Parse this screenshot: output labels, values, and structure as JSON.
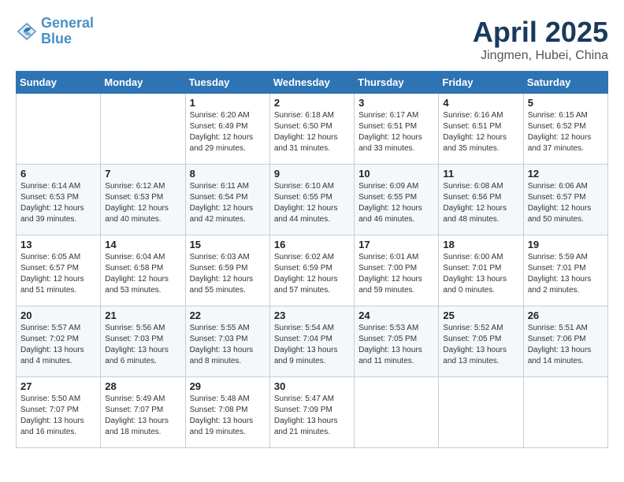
{
  "header": {
    "logo_line1": "General",
    "logo_line2": "Blue",
    "month_title": "April 2025",
    "location": "Jingmen, Hubei, China"
  },
  "days_of_week": [
    "Sunday",
    "Monday",
    "Tuesday",
    "Wednesday",
    "Thursday",
    "Friday",
    "Saturday"
  ],
  "weeks": [
    [
      {
        "day": "",
        "info": ""
      },
      {
        "day": "",
        "info": ""
      },
      {
        "day": "1",
        "info": "Sunrise: 6:20 AM\nSunset: 6:49 PM\nDaylight: 12 hours\nand 29 minutes."
      },
      {
        "day": "2",
        "info": "Sunrise: 6:18 AM\nSunset: 6:50 PM\nDaylight: 12 hours\nand 31 minutes."
      },
      {
        "day": "3",
        "info": "Sunrise: 6:17 AM\nSunset: 6:51 PM\nDaylight: 12 hours\nand 33 minutes."
      },
      {
        "day": "4",
        "info": "Sunrise: 6:16 AM\nSunset: 6:51 PM\nDaylight: 12 hours\nand 35 minutes."
      },
      {
        "day": "5",
        "info": "Sunrise: 6:15 AM\nSunset: 6:52 PM\nDaylight: 12 hours\nand 37 minutes."
      }
    ],
    [
      {
        "day": "6",
        "info": "Sunrise: 6:14 AM\nSunset: 6:53 PM\nDaylight: 12 hours\nand 39 minutes."
      },
      {
        "day": "7",
        "info": "Sunrise: 6:12 AM\nSunset: 6:53 PM\nDaylight: 12 hours\nand 40 minutes."
      },
      {
        "day": "8",
        "info": "Sunrise: 6:11 AM\nSunset: 6:54 PM\nDaylight: 12 hours\nand 42 minutes."
      },
      {
        "day": "9",
        "info": "Sunrise: 6:10 AM\nSunset: 6:55 PM\nDaylight: 12 hours\nand 44 minutes."
      },
      {
        "day": "10",
        "info": "Sunrise: 6:09 AM\nSunset: 6:55 PM\nDaylight: 12 hours\nand 46 minutes."
      },
      {
        "day": "11",
        "info": "Sunrise: 6:08 AM\nSunset: 6:56 PM\nDaylight: 12 hours\nand 48 minutes."
      },
      {
        "day": "12",
        "info": "Sunrise: 6:06 AM\nSunset: 6:57 PM\nDaylight: 12 hours\nand 50 minutes."
      }
    ],
    [
      {
        "day": "13",
        "info": "Sunrise: 6:05 AM\nSunset: 6:57 PM\nDaylight: 12 hours\nand 51 minutes."
      },
      {
        "day": "14",
        "info": "Sunrise: 6:04 AM\nSunset: 6:58 PM\nDaylight: 12 hours\nand 53 minutes."
      },
      {
        "day": "15",
        "info": "Sunrise: 6:03 AM\nSunset: 6:59 PM\nDaylight: 12 hours\nand 55 minutes."
      },
      {
        "day": "16",
        "info": "Sunrise: 6:02 AM\nSunset: 6:59 PM\nDaylight: 12 hours\nand 57 minutes."
      },
      {
        "day": "17",
        "info": "Sunrise: 6:01 AM\nSunset: 7:00 PM\nDaylight: 12 hours\nand 59 minutes."
      },
      {
        "day": "18",
        "info": "Sunrise: 6:00 AM\nSunset: 7:01 PM\nDaylight: 13 hours\nand 0 minutes."
      },
      {
        "day": "19",
        "info": "Sunrise: 5:59 AM\nSunset: 7:01 PM\nDaylight: 13 hours\nand 2 minutes."
      }
    ],
    [
      {
        "day": "20",
        "info": "Sunrise: 5:57 AM\nSunset: 7:02 PM\nDaylight: 13 hours\nand 4 minutes."
      },
      {
        "day": "21",
        "info": "Sunrise: 5:56 AM\nSunset: 7:03 PM\nDaylight: 13 hours\nand 6 minutes."
      },
      {
        "day": "22",
        "info": "Sunrise: 5:55 AM\nSunset: 7:03 PM\nDaylight: 13 hours\nand 8 minutes."
      },
      {
        "day": "23",
        "info": "Sunrise: 5:54 AM\nSunset: 7:04 PM\nDaylight: 13 hours\nand 9 minutes."
      },
      {
        "day": "24",
        "info": "Sunrise: 5:53 AM\nSunset: 7:05 PM\nDaylight: 13 hours\nand 11 minutes."
      },
      {
        "day": "25",
        "info": "Sunrise: 5:52 AM\nSunset: 7:05 PM\nDaylight: 13 hours\nand 13 minutes."
      },
      {
        "day": "26",
        "info": "Sunrise: 5:51 AM\nSunset: 7:06 PM\nDaylight: 13 hours\nand 14 minutes."
      }
    ],
    [
      {
        "day": "27",
        "info": "Sunrise: 5:50 AM\nSunset: 7:07 PM\nDaylight: 13 hours\nand 16 minutes."
      },
      {
        "day": "28",
        "info": "Sunrise: 5:49 AM\nSunset: 7:07 PM\nDaylight: 13 hours\nand 18 minutes."
      },
      {
        "day": "29",
        "info": "Sunrise: 5:48 AM\nSunset: 7:08 PM\nDaylight: 13 hours\nand 19 minutes."
      },
      {
        "day": "30",
        "info": "Sunrise: 5:47 AM\nSunset: 7:09 PM\nDaylight: 13 hours\nand 21 minutes."
      },
      {
        "day": "",
        "info": ""
      },
      {
        "day": "",
        "info": ""
      },
      {
        "day": "",
        "info": ""
      }
    ]
  ]
}
